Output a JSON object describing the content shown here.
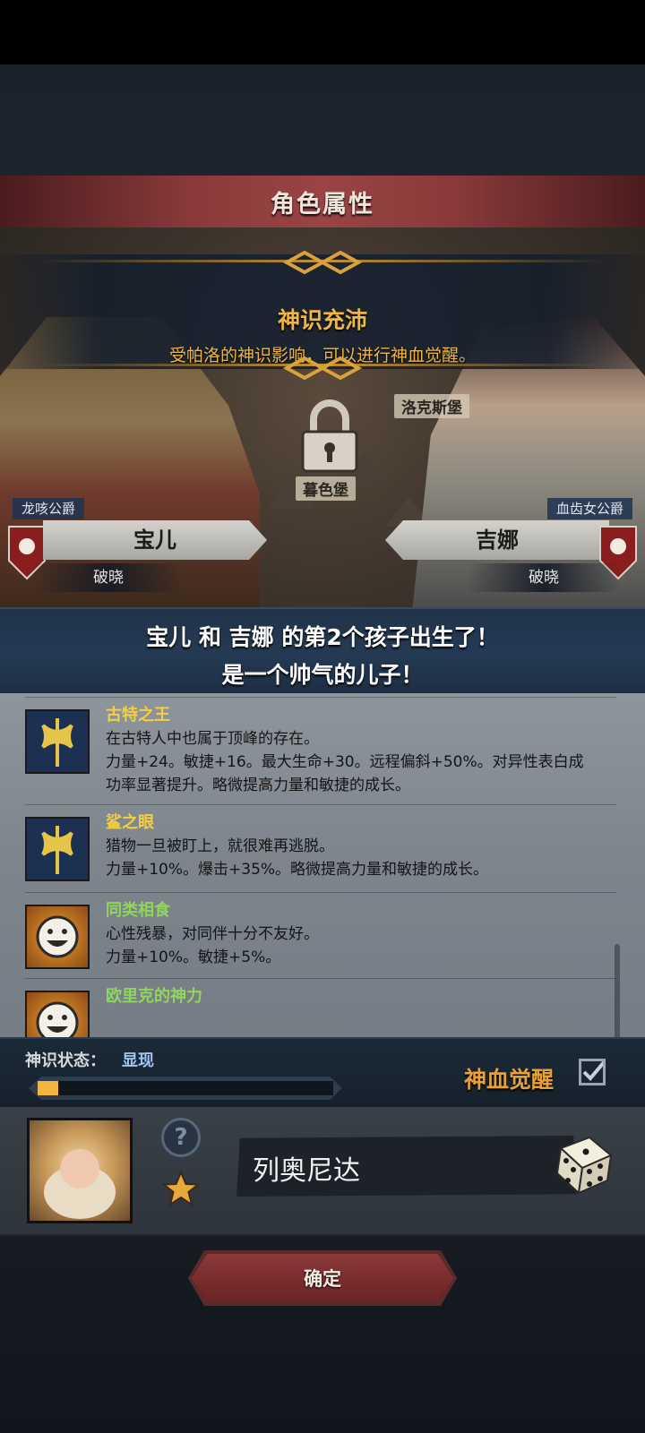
{
  "header": {
    "title": "角色属性"
  },
  "banner": {
    "title": "神识充沛",
    "subtitle": "受帕洛的神识影响，可以进行神血觉醒。"
  },
  "map": {
    "labels": [
      "洛克斯堡",
      "暮色堡"
    ]
  },
  "father": {
    "title": "龙咳公爵",
    "name": "宝儿",
    "house": "破晓"
  },
  "mother": {
    "title": "血齿女公爵",
    "name": "吉娜",
    "house": "破晓"
  },
  "announcement": {
    "line1": "宝儿 和 吉娜 的第2个孩子出生了！",
    "line2": "是一个帅气的儿子！"
  },
  "traits": [
    {
      "name": "古特之王",
      "name_color": "#f2d040",
      "icon": "axe-icon",
      "desc": "在古特人中也属于顶峰的存在。\n力量+24。敏捷+16。最大生命+30。远程偏斜+50%。对异性表白成\n功率显著提升。略微提高力量和敏捷的成长。"
    },
    {
      "name": "鲨之眼",
      "name_color": "#f2d040",
      "icon": "axe-icon",
      "desc": "猎物一旦被盯上，就很难再逃脱。\n力量+10%。爆击+35%。略微提高力量和敏捷的成长。"
    },
    {
      "name": "同类相食",
      "name_color": "#8fd65a",
      "icon": "grin-face-icon",
      "desc": "心性残暴，对同伴十分不友好。\n力量+10%。敏捷+5%。"
    },
    {
      "name": "欧里克的神力",
      "name_color": "#8fd65a",
      "icon": "grin-face-icon",
      "desc": ""
    }
  ],
  "status": {
    "label": "神识状态：",
    "value": "显现",
    "progress": 0.07,
    "awaken_label": "神血觉醒",
    "awaken_checked": true
  },
  "child": {
    "name": "列奥尼达",
    "help_symbol": "?"
  },
  "confirm": {
    "label": "确定"
  }
}
